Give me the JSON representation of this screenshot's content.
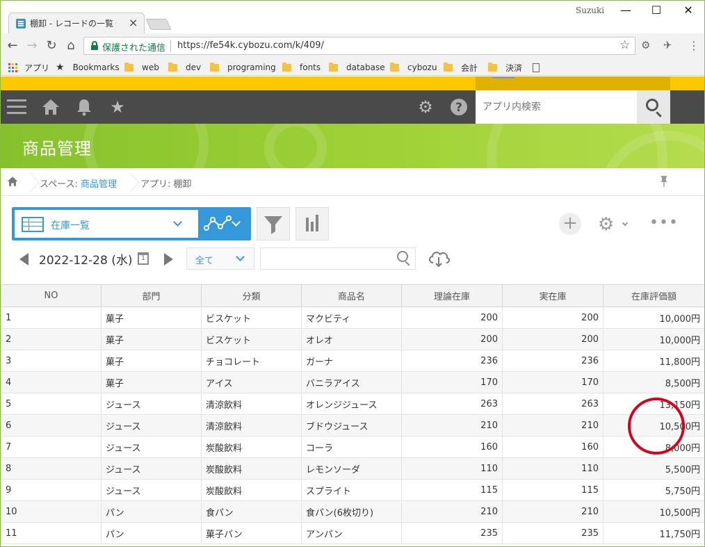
{
  "browser": {
    "tab_title": "棚卸 - レコードの一覧",
    "user": "Suzuki",
    "secure_label": "保護された通信",
    "url": "https://fe54k.cybozu.com/k/409/",
    "bookmarks": [
      {
        "label": "アプリ",
        "icon": "apps-grid-icon"
      },
      {
        "label": "Bookmarks",
        "icon": "star-icon"
      },
      {
        "label": "web",
        "icon": "folder-icon"
      },
      {
        "label": "dev",
        "icon": "folder-icon"
      },
      {
        "label": "programing",
        "icon": "folder-icon"
      },
      {
        "label": "fonts",
        "icon": "folder-icon"
      },
      {
        "label": "database",
        "icon": "folder-icon"
      },
      {
        "label": "cybozu",
        "icon": "folder-icon"
      },
      {
        "label": "会計",
        "icon": "folder-icon"
      },
      {
        "label": "決済",
        "icon": "folder-icon"
      }
    ]
  },
  "header": {
    "search_placeholder": "アプリ内検索"
  },
  "banner": {
    "title": "商品管理"
  },
  "breadcrumb": {
    "space_prefix": "スペース: ",
    "space_name": "商品管理",
    "app": "アプリ: 棚卸"
  },
  "view": {
    "name": "在庫一覧"
  },
  "date_nav": {
    "date": "2022-12-28 (水)",
    "calendar_day": "1",
    "filter": "全て"
  },
  "table": {
    "columns": [
      "NO",
      "部門",
      "分類",
      "商品名",
      "理論在庫",
      "実在庫",
      "在庫評価額"
    ],
    "rows": [
      [
        "1",
        "菓子",
        "ビスケット",
        "マクビティ",
        "200",
        "200",
        "10,000円"
      ],
      [
        "2",
        "菓子",
        "ビスケット",
        "オレオ",
        "200",
        "200",
        "10,000円"
      ],
      [
        "3",
        "菓子",
        "チョコレート",
        "ガーナ",
        "236",
        "236",
        "11,800円"
      ],
      [
        "4",
        "菓子",
        "アイス",
        "バニラアイス",
        "170",
        "170",
        "8,500円"
      ],
      [
        "5",
        "ジュース",
        "清涼飲料",
        "オレンジジュース",
        "263",
        "263",
        "13,150円"
      ],
      [
        "6",
        "ジュース",
        "清涼飲料",
        "ブドウジュース",
        "210",
        "210",
        "10,500円"
      ],
      [
        "7",
        "ジュース",
        "炭酸飲料",
        "コーラ",
        "160",
        "160",
        "8,000円"
      ],
      [
        "8",
        "ジュース",
        "炭酸飲料",
        "レモンソーダ",
        "110",
        "110",
        "5,500円"
      ],
      [
        "9",
        "ジュース",
        "炭酸飲料",
        "スプライト",
        "115",
        "115",
        "5,750円"
      ],
      [
        "10",
        "パン",
        "食パン",
        "食パン(6枚切り)",
        "210",
        "210",
        "10,500円"
      ],
      [
        "11",
        "パン",
        "菓子パン",
        "アンパン",
        "235",
        "235",
        "11,750円"
      ]
    ]
  },
  "colors": {
    "accent": "#3498db",
    "banner_green": "#8cc63f",
    "header_dark": "#4a4a4a",
    "yellow_bar": "#fcc800",
    "annotation": "#d6001c"
  }
}
